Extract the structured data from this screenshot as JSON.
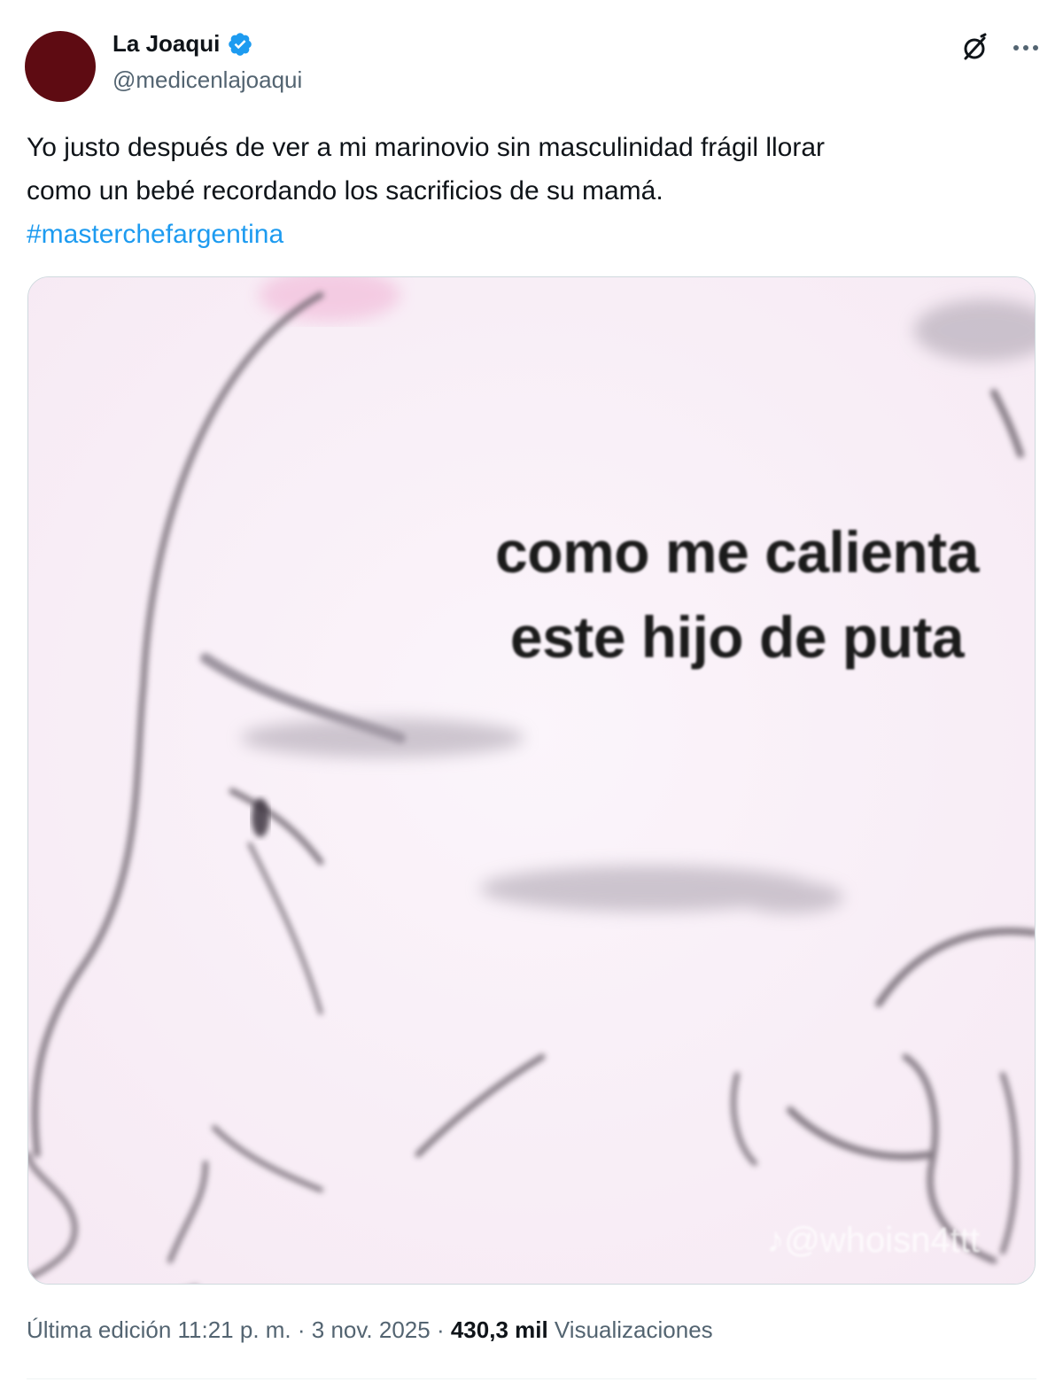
{
  "author": {
    "name": "La Joaqui",
    "handle": "@medicenlajoaqui",
    "verified": true,
    "avatar_color": "#5e0b12",
    "verified_color": "#1d9bf0"
  },
  "actions": {
    "grok_icon": "grok-icon",
    "more_icon": "more-icon"
  },
  "tweet": {
    "text_line1": "Yo justo después de ver a mi marinovio sin masculinidad frágil llorar",
    "text_line2": "como un bebé recordando los sacrificios de su mamá.",
    "hashtag": "#masterchefargentina",
    "hashtag_color": "#1d9bf0"
  },
  "media": {
    "caption_line1": "como me calienta",
    "caption_line2": "este hijo de puta",
    "watermark": "♪@whoisn4ttt"
  },
  "meta": {
    "edited_label": "Última edición 11:21 p. m. · 3 nov. 2025 · ",
    "views_count": "430,3 mil",
    "views_label": " Visualizaciones"
  }
}
